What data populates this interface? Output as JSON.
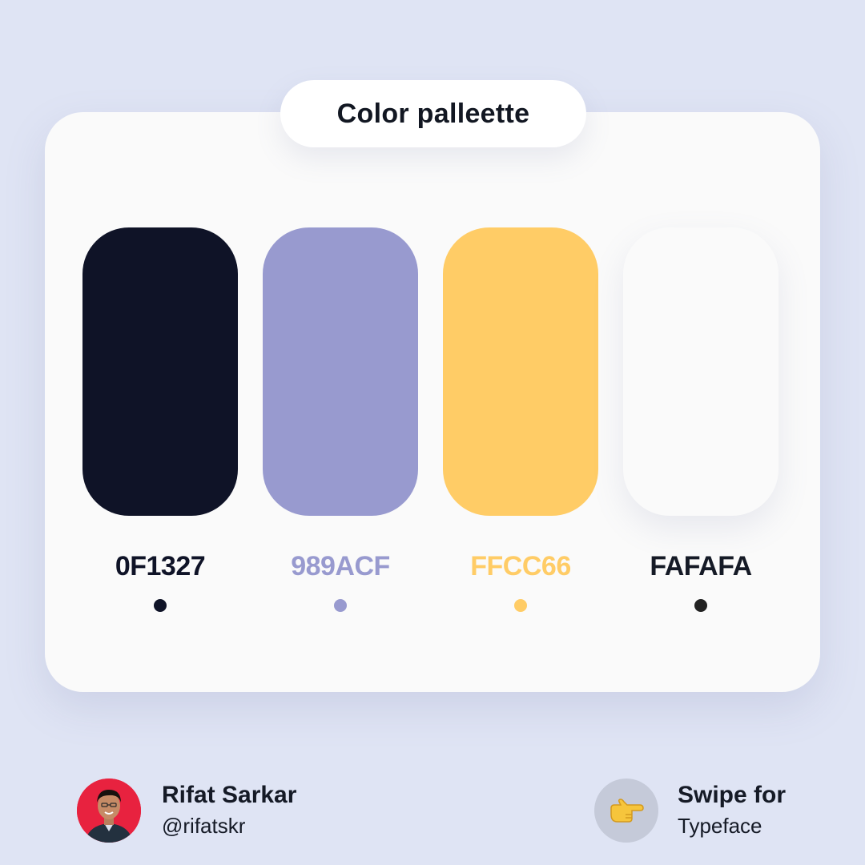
{
  "title": "Color palleette",
  "colors": [
    {
      "hex_label": "0F1327",
      "swatch_color": "#0f1327",
      "label_color": "#0f1327",
      "dot_color": "#0f1327"
    },
    {
      "hex_label": "989ACF",
      "swatch_color": "#989acf",
      "label_color": "#989acf",
      "dot_color": "#989acf"
    },
    {
      "hex_label": "FFCC66",
      "swatch_color": "#ffcc66",
      "label_color": "#ffcc66",
      "dot_color": "#ffcc66"
    },
    {
      "hex_label": "FAFAFA",
      "swatch_color": "#fafafa",
      "label_color": "#151a26",
      "dot_color": "#222222"
    }
  ],
  "author": {
    "name": "Rifat Sarkar",
    "handle": "@rifatskr",
    "avatar_icon": "person-avatar-icon"
  },
  "swipe": {
    "title": "Swipe for",
    "subtitle": "Typeface",
    "icon": "pointing-hand-icon"
  }
}
